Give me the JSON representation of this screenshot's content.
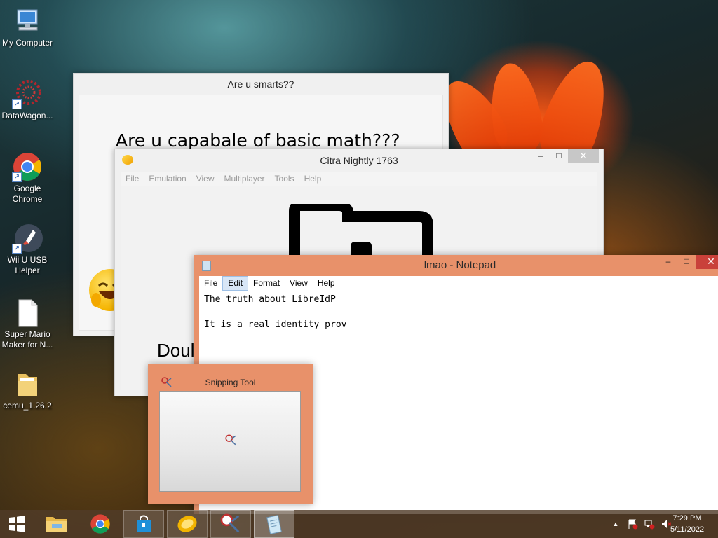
{
  "desktop": {
    "icons": [
      {
        "label": "My Computer"
      },
      {
        "label": "DataWagon..."
      },
      {
        "label": "Google Chrome"
      },
      {
        "label": "Wii U USB Helper"
      },
      {
        "label": "Super Mario Maker for N..."
      },
      {
        "label": "cemu_1.26.2"
      }
    ]
  },
  "math_window": {
    "title": "Are u smarts??",
    "question": "Are u capabale of basic math???"
  },
  "citra_window": {
    "title": "Citra Nightly 1763",
    "menu": [
      "File",
      "Emulation",
      "View",
      "Multiplayer",
      "Tools",
      "Help"
    ],
    "partial_text": "Doul"
  },
  "notepad_window": {
    "title": "lmao - Notepad",
    "menu": [
      "File",
      "Edit",
      "Format",
      "View",
      "Help"
    ],
    "active_menu": "Edit",
    "content": "The truth about LibreIdP\n\nIt is a real identity prov"
  },
  "snipping_window": {
    "title": "Snipping Tool"
  },
  "window_controls": {
    "minimize": "–",
    "maximize": "□",
    "close": "✕"
  },
  "taskbar": {
    "pinned": [
      {
        "name": "start",
        "icon": "windows-logo-icon"
      },
      {
        "name": "file-explorer",
        "icon": "folder-icon"
      },
      {
        "name": "google-chrome",
        "icon": "chrome-icon"
      },
      {
        "name": "store",
        "icon": "store-bag-icon"
      },
      {
        "name": "citra",
        "icon": "citra-icon"
      },
      {
        "name": "snipping-tool",
        "icon": "scissors-icon"
      },
      {
        "name": "notepad",
        "icon": "notepad-icon"
      }
    ],
    "tray": {
      "show_hidden": "▲",
      "time": "7:29 PM",
      "date": "5/11/2022"
    }
  },
  "colors": {
    "active_window_frame": "#e8916a",
    "close_button_active": "#c9413a",
    "taskbar": "#50382a"
  }
}
